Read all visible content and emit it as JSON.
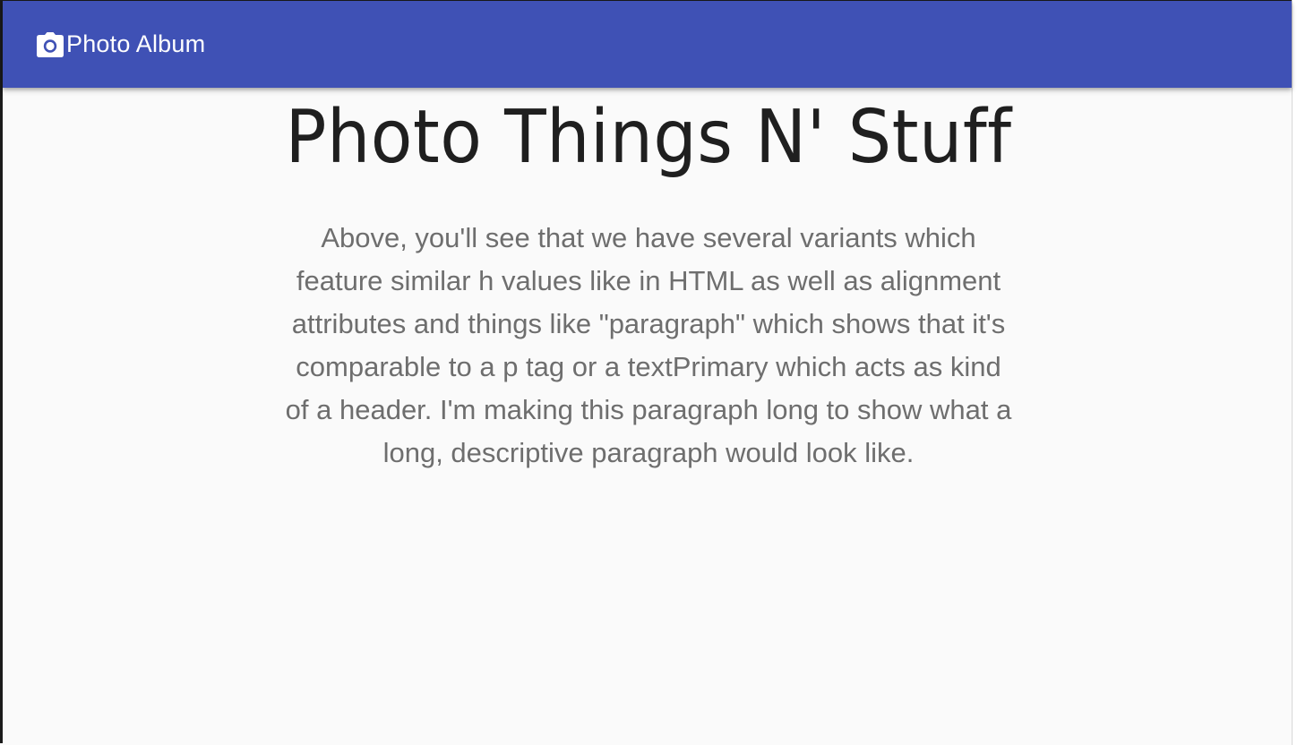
{
  "appbar": {
    "icon": "camera-icon",
    "title": "Photo Album",
    "background": "#3f51b5"
  },
  "main": {
    "heading": "Photo Things N' Stuff",
    "paragraph": "Above, you'll see that we have several variants which feature similar h values like in HTML as well as alignment attributes and things like \"paragraph\" which shows that it's comparable to a p tag or a textPrimary which acts as kind of a header. I'm making this paragraph long to show what a long, descriptive paragraph would look like."
  }
}
